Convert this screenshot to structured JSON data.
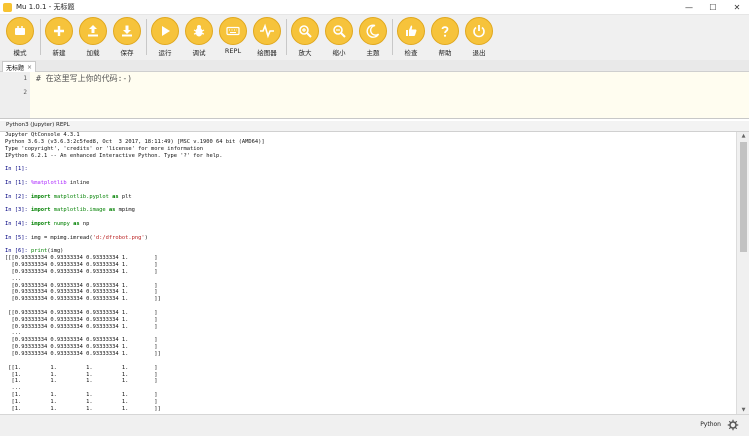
{
  "window": {
    "title": "Mu 1.0.1 - 无标题",
    "controls": [
      "—",
      "☐",
      "✕"
    ]
  },
  "toolbar": {
    "buttons": [
      {
        "label": "模式",
        "icon": "mode-icon"
      },
      {
        "label": "新建",
        "icon": "plus-icon"
      },
      {
        "label": "加载",
        "icon": "upload-icon"
      },
      {
        "label": "保存",
        "icon": "download-icon"
      },
      {
        "label": "运行",
        "icon": "play-icon"
      },
      {
        "label": "调试",
        "icon": "bug-icon"
      },
      {
        "label": "REPL",
        "icon": "keyboard-icon"
      },
      {
        "label": "绘图器",
        "icon": "plotter-icon"
      },
      {
        "label": "放大",
        "icon": "zoom-in-icon"
      },
      {
        "label": "缩小",
        "icon": "zoom-out-icon"
      },
      {
        "label": "主题",
        "icon": "moon-icon"
      },
      {
        "label": "检查",
        "icon": "thumbs-up-icon"
      },
      {
        "label": "帮助",
        "icon": "help-icon"
      },
      {
        "label": "退出",
        "icon": "power-icon"
      }
    ]
  },
  "editor": {
    "tab_label": "无标题",
    "tab_close": "×",
    "line_numbers": [
      "1",
      "2"
    ],
    "code_line": "# 在这里写上你的代码:-)"
  },
  "repl": {
    "tab_label": "Python3 (Jupyter) REPL",
    "banner": [
      "Jupyter QtConsole 4.3.1",
      "Python 3.6.3 (v3.6.3:2c5fed8, Oct  3 2017, 18:11:49) [MSC v.1900 64 bit (AMD64)]",
      "Type 'copyright', 'credits' or 'license' for more information",
      "IPython 6.2.1 -- An enhanced Interactive Python. Type '?' for help."
    ],
    "in1": "In [1]:",
    "in1b": "In [1]:",
    "in1b_magic": "%matplotlib",
    "in1b_rest": " inline",
    "in2": "In [2]:",
    "in2_kw1": "import",
    "in2_mod": " matplotlib.pyplot ",
    "in2_kw2": "as",
    "in2_alias": " plt",
    "in3": "In [3]:",
    "in3_kw1": "import",
    "in3_mod": " matplotlib.image ",
    "in3_kw2": "as",
    "in3_alias": " mpimg",
    "in4": "In [4]:",
    "in4_kw1": "import",
    "in4_mod": " numpy ",
    "in4_kw2": "as",
    "in4_alias": " np",
    "in5": "In [5]:",
    "in5_code": " img = mpimg.imread(",
    "in5_str": "'d:/dfrobot.png'",
    "in5_close": ")",
    "in6": "In [6]:",
    "in6_fn": " print",
    "in6_rest": "(img)",
    "output_block1": "[[[0.93333334 0.93333334 0.93333334 1.        ]\n  [0.93333334 0.93333334 0.93333334 1.        ]\n  [0.93333334 0.93333334 0.93333334 1.        ]\n  ...\n  [0.93333334 0.93333334 0.93333334 1.        ]\n  [0.93333334 0.93333334 0.93333334 1.        ]\n  [0.93333334 0.93333334 0.93333334 1.        ]]",
    "output_block2": " [[0.93333334 0.93333334 0.93333334 1.        ]\n  [0.93333334 0.93333334 0.93333334 1.        ]\n  [0.93333334 0.93333334 0.93333334 1.        ]\n  ...\n  [0.93333334 0.93333334 0.93333334 1.        ]\n  [0.93333334 0.93333334 0.93333334 1.        ]\n  [0.93333334 0.93333334 0.93333334 1.        ]]",
    "output_block3": " [[1.         1.         1.         1.        ]\n  [1.         1.         1.         1.        ]\n  [1.         1.         1.         1.        ]\n  ...\n  [1.         1.         1.         1.        ]\n  [1.         1.         1.         1.        ]\n  [1.         1.         1.         1.        ]]"
  },
  "status": {
    "mode": "Python"
  },
  "colors": {
    "button_fill": "#f6c33b",
    "editor_bg": "#fffdf0",
    "prompt": "#000080",
    "keyword": "#008000"
  }
}
